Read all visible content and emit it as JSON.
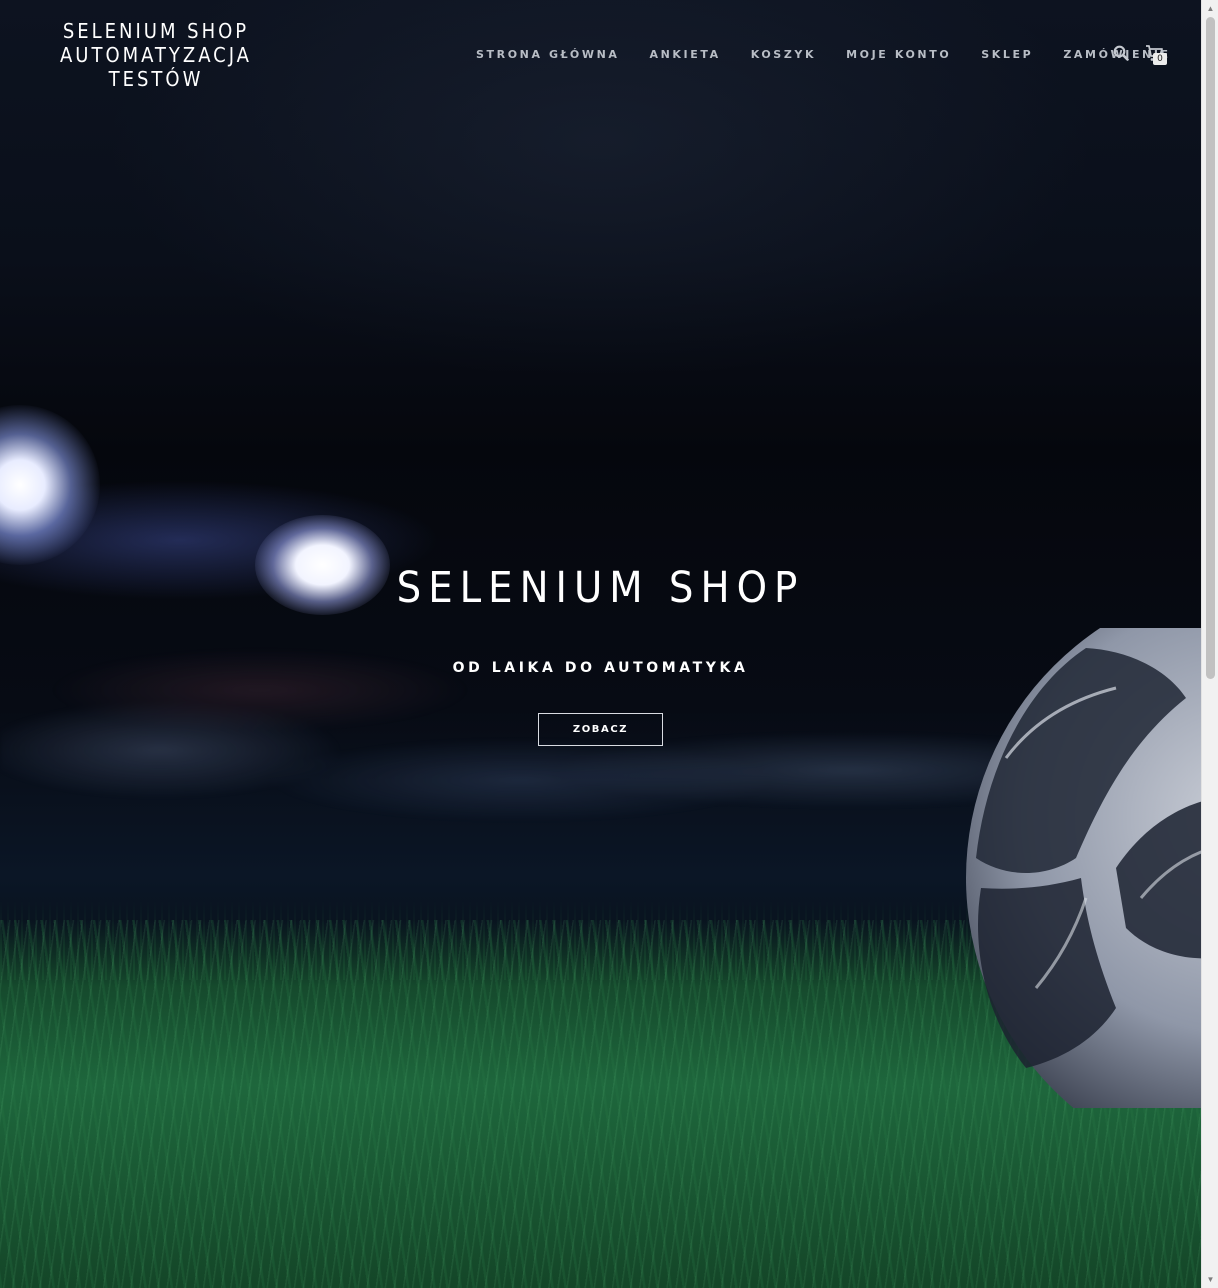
{
  "header": {
    "logo_lines": [
      "SELENIUM SHOP",
      "AUTOMATYZACJA",
      "TESTÓW"
    ]
  },
  "nav": {
    "items": [
      {
        "label": "STRONA GŁÓWNA"
      },
      {
        "label": "ANKIETA"
      },
      {
        "label": "KOSZYK"
      },
      {
        "label": "MOJE KONTO"
      },
      {
        "label": "SKLEP"
      },
      {
        "label": "ZAMÓWIENIE"
      }
    ],
    "search_icon": "search-icon",
    "cart_icon": "cart-icon",
    "cart_count": "0"
  },
  "hero": {
    "title": "SELENIUM SHOP",
    "subtitle": "OD LAIKA DO AUTOMATYKA",
    "button_label": "ZOBACZ"
  },
  "scrollbar": {
    "up_icon": "arrow-up-icon",
    "down_icon": "arrow-down-icon",
    "position": 0
  },
  "colors": {
    "nav_text": "#b8bdc5",
    "hero_text": "#ffffff",
    "button_border": "#d9dce2",
    "cart_badge": "#ececec"
  }
}
